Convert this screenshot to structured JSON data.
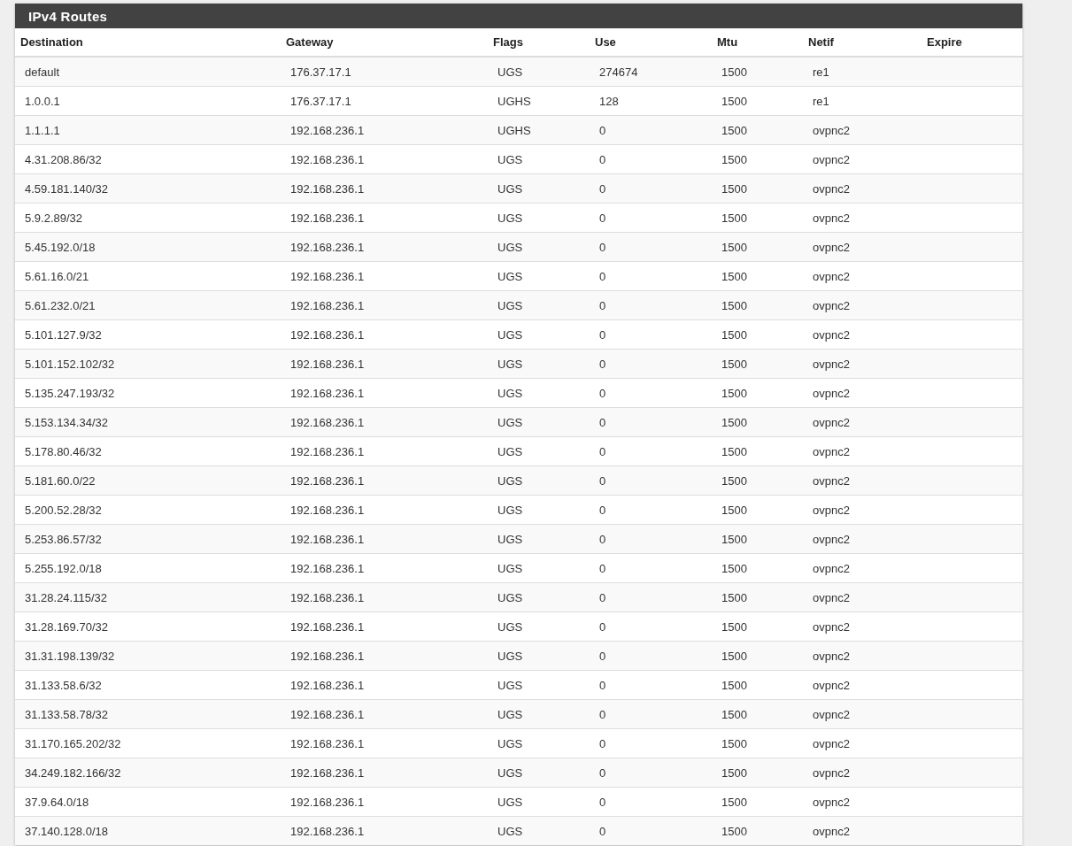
{
  "panel": {
    "title": "IPv4 Routes"
  },
  "table": {
    "columns": [
      "Destination",
      "Gateway",
      "Flags",
      "Use",
      "Mtu",
      "Netif",
      "Expire"
    ],
    "rows": [
      {
        "destination": "default",
        "gateway": "176.37.17.1",
        "flags": "UGS",
        "use": "274674",
        "mtu": "1500",
        "netif": "re1"
      },
      {
        "destination": "1.0.0.1",
        "gateway": "176.37.17.1",
        "flags": "UGHS",
        "use": "128",
        "mtu": "1500",
        "netif": "re1"
      },
      {
        "destination": "1.1.1.1",
        "gateway": "192.168.236.1",
        "flags": "UGHS",
        "use": "0",
        "mtu": "1500",
        "netif": "ovpnc2"
      },
      {
        "destination": "4.31.208.86/32",
        "gateway": "192.168.236.1",
        "flags": "UGS",
        "use": "0",
        "mtu": "1500",
        "netif": "ovpnc2"
      },
      {
        "destination": "4.59.181.140/32",
        "gateway": "192.168.236.1",
        "flags": "UGS",
        "use": "0",
        "mtu": "1500",
        "netif": "ovpnc2"
      },
      {
        "destination": "5.9.2.89/32",
        "gateway": "192.168.236.1",
        "flags": "UGS",
        "use": "0",
        "mtu": "1500",
        "netif": "ovpnc2"
      },
      {
        "destination": "5.45.192.0/18",
        "gateway": "192.168.236.1",
        "flags": "UGS",
        "use": "0",
        "mtu": "1500",
        "netif": "ovpnc2"
      },
      {
        "destination": "5.61.16.0/21",
        "gateway": "192.168.236.1",
        "flags": "UGS",
        "use": "0",
        "mtu": "1500",
        "netif": "ovpnc2"
      },
      {
        "destination": "5.61.232.0/21",
        "gateway": "192.168.236.1",
        "flags": "UGS",
        "use": "0",
        "mtu": "1500",
        "netif": "ovpnc2"
      },
      {
        "destination": "5.101.127.9/32",
        "gateway": "192.168.236.1",
        "flags": "UGS",
        "use": "0",
        "mtu": "1500",
        "netif": "ovpnc2"
      },
      {
        "destination": "5.101.152.102/32",
        "gateway": "192.168.236.1",
        "flags": "UGS",
        "use": "0",
        "mtu": "1500",
        "netif": "ovpnc2"
      },
      {
        "destination": "5.135.247.193/32",
        "gateway": "192.168.236.1",
        "flags": "UGS",
        "use": "0",
        "mtu": "1500",
        "netif": "ovpnc2"
      },
      {
        "destination": "5.153.134.34/32",
        "gateway": "192.168.236.1",
        "flags": "UGS",
        "use": "0",
        "mtu": "1500",
        "netif": "ovpnc2"
      },
      {
        "destination": "5.178.80.46/32",
        "gateway": "192.168.236.1",
        "flags": "UGS",
        "use": "0",
        "mtu": "1500",
        "netif": "ovpnc2"
      },
      {
        "destination": "5.181.60.0/22",
        "gateway": "192.168.236.1",
        "flags": "UGS",
        "use": "0",
        "mtu": "1500",
        "netif": "ovpnc2"
      },
      {
        "destination": "5.200.52.28/32",
        "gateway": "192.168.236.1",
        "flags": "UGS",
        "use": "0",
        "mtu": "1500",
        "netif": "ovpnc2"
      },
      {
        "destination": "5.253.86.57/32",
        "gateway": "192.168.236.1",
        "flags": "UGS",
        "use": "0",
        "mtu": "1500",
        "netif": "ovpnc2"
      },
      {
        "destination": "5.255.192.0/18",
        "gateway": "192.168.236.1",
        "flags": "UGS",
        "use": "0",
        "mtu": "1500",
        "netif": "ovpnc2"
      },
      {
        "destination": "31.28.24.115/32",
        "gateway": "192.168.236.1",
        "flags": "UGS",
        "use": "0",
        "mtu": "1500",
        "netif": "ovpnc2"
      },
      {
        "destination": "31.28.169.70/32",
        "gateway": "192.168.236.1",
        "flags": "UGS",
        "use": "0",
        "mtu": "1500",
        "netif": "ovpnc2"
      },
      {
        "destination": "31.31.198.139/32",
        "gateway": "192.168.236.1",
        "flags": "UGS",
        "use": "0",
        "mtu": "1500",
        "netif": "ovpnc2"
      },
      {
        "destination": "31.133.58.6/32",
        "gateway": "192.168.236.1",
        "flags": "UGS",
        "use": "0",
        "mtu": "1500",
        "netif": "ovpnc2"
      },
      {
        "destination": "31.133.58.78/32",
        "gateway": "192.168.236.1",
        "flags": "UGS",
        "use": "0",
        "mtu": "1500",
        "netif": "ovpnc2"
      },
      {
        "destination": "31.170.165.202/32",
        "gateway": "192.168.236.1",
        "flags": "UGS",
        "use": "0",
        "mtu": "1500",
        "netif": "ovpnc2"
      },
      {
        "destination": "34.249.182.166/32",
        "gateway": "192.168.236.1",
        "flags": "UGS",
        "use": "0",
        "mtu": "1500",
        "netif": "ovpnc2"
      },
      {
        "destination": "37.9.64.0/18",
        "gateway": "192.168.236.1",
        "flags": "UGS",
        "use": "0",
        "mtu": "1500",
        "netif": "ovpnc2"
      },
      {
        "destination": "37.140.128.0/18",
        "gateway": "192.168.236.1",
        "flags": "UGS",
        "use": "0",
        "mtu": "1500",
        "netif": "ovpnc2"
      }
    ]
  }
}
